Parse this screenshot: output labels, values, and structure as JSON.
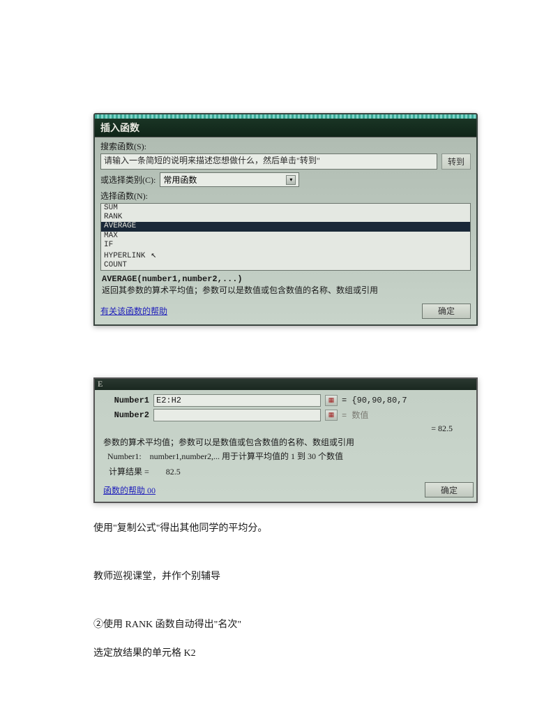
{
  "dialog1": {
    "title": "插入函数",
    "search_label": "搜索函数(S):",
    "search_text": "请输入一条简短的说明来描述您想做什么，然后单击\"转到\"",
    "go_btn": "转到",
    "category_label": "或选择类别(C):",
    "category_value": "常用函数",
    "list_label": "选择函数(N):",
    "functions": [
      "SUM",
      "RANK",
      "AVERAGE",
      "MAX",
      "IF",
      "HYPERLINK",
      "COUNT"
    ],
    "selected_index": 2,
    "syntax": "AVERAGE(number1,number2,...)",
    "description": "返回其参数的算术平均值；参数可以是数值或包含数值的名称、数组或引用",
    "help_link": "有关该函数的帮助",
    "ok_btn": "确定"
  },
  "dialog2": {
    "title_corner": "E",
    "arg1_label": "Number1",
    "arg1_value": "E2:H2",
    "arg1_preview": "= {90,90,80,7",
    "arg2_label": "Number2",
    "arg2_value": "",
    "arg2_preview": "= 数值",
    "result_inline": "= 82.5",
    "description": "参数的算术平均值；参数可以是数值或包含数值的名称、数组或引用",
    "arg_desc_label": "Number1:",
    "arg_desc_text": "number1,number2,... 用于计算平均值的 1 到 30 个数值",
    "calc_label": "计算结果 =",
    "calc_value": "82.5",
    "help_link": "函数的帮助 00",
    "ok_btn": "确定"
  },
  "doc": {
    "para1": "使用\"复制公式\"得出其他同学的平均分。",
    "para2": "教师巡视课堂，并作个别辅导",
    "para3": " ②使用 RANK 函数自动得出\"名次\"",
    "para4": "选定放结果的单元格 K2"
  }
}
